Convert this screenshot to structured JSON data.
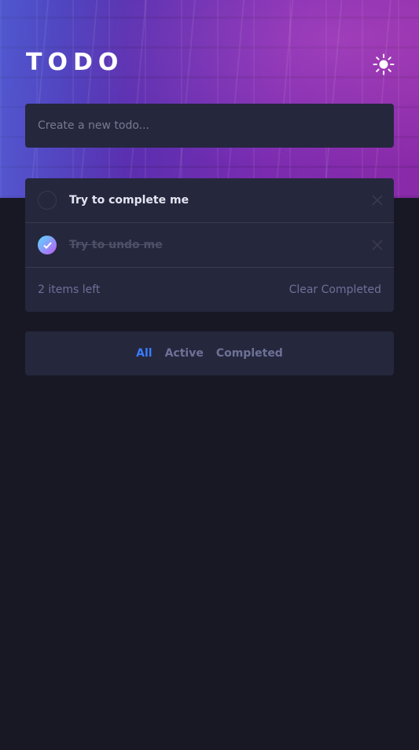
{
  "app": {
    "title": "TODO"
  },
  "header": {
    "theme_icon": "sun-icon"
  },
  "create": {
    "placeholder": "Create a new todo..."
  },
  "todos": [
    {
      "text": "Try to complete me",
      "completed": false
    },
    {
      "text": "Try to undo me",
      "completed": true
    }
  ],
  "footer": {
    "items_left": "2 items left",
    "clear_label": "Clear Completed"
  },
  "filters": [
    {
      "label": "All",
      "active": true
    },
    {
      "label": "Active",
      "active": false
    },
    {
      "label": "Completed",
      "active": false
    }
  ],
  "colors": {
    "background": "#181824",
    "card": "#25273d",
    "accent": "#3a7bfd",
    "check_gradient_start": "#57ddff",
    "check_gradient_end": "#c058f3"
  }
}
